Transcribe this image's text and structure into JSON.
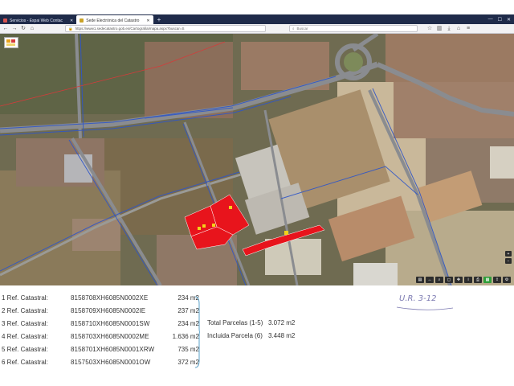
{
  "browser": {
    "tabs": [
      {
        "label": "Servicios - Espai Web Contac",
        "active": false
      },
      {
        "label": "Sede Electrónica del Catastro",
        "active": true
      }
    ],
    "url": "https://www1.sedecatastro.gob.es/Cartografia/mapa.aspx?buscar=S",
    "search_placeholder": "Buscar"
  },
  "parcels": [
    {
      "label": "1 Ref. Catastral:",
      "ref": "8158708XH6085N0002XE",
      "area": "234 m2"
    },
    {
      "label": "2 Ref. Catastral:",
      "ref": "8158709XH6085N0002IE",
      "area": "237 m2"
    },
    {
      "label": "3 Ref. Catastral:",
      "ref": "8158710XH6085N0001SW",
      "area": "234 m2"
    },
    {
      "label": "4 Ref. Catastral:",
      "ref": "8158703XH6085N0002ME",
      "area": "1.636 m2"
    },
    {
      "label": "5 Ref. Catastral:",
      "ref": "8158701XH6085N0001XRW",
      "area": "735 m2"
    },
    {
      "label": "6 Ref. Catastral:",
      "ref": "8157503XH6085N0001OW",
      "area": "372 m2"
    }
  ],
  "totals": [
    {
      "label": "Total Parcelas (1-5)",
      "value": "3.072 m2"
    },
    {
      "label": "Incluida Parcela (6)",
      "value": "3.448 m2"
    }
  ],
  "stamp": "U.R. 3-12",
  "colors": {
    "parcel_highlight": "#e8141c",
    "road": "#8a8c90",
    "boundary": "#2f56c8",
    "stamp": "#7d7bb2"
  }
}
